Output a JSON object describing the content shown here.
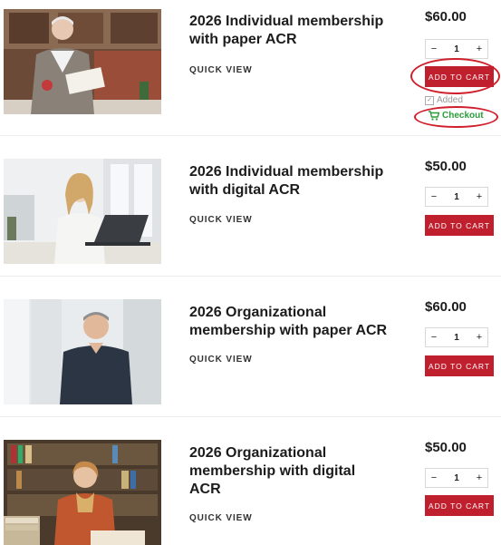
{
  "products": [
    {
      "title_line1": "2026 Individual membership",
      "title_line2": "with paper ACR",
      "title_line3": "",
      "quick_view": "QUICK VIEW",
      "price": "$60.00",
      "qty_minus": "−",
      "qty_value": "1",
      "qty_plus": "+",
      "add_to_cart": "ADD TO CART",
      "added_label": "Added",
      "checkout_label": "Checkout",
      "photo_icon": "woman-reading-photo"
    },
    {
      "title_line1": "2026 Individual membership",
      "title_line2": "with digital ACR",
      "title_line3": "",
      "quick_view": "QUICK VIEW",
      "price": "$50.00",
      "qty_minus": "−",
      "qty_value": "1",
      "qty_plus": "+",
      "add_to_cart": "ADD TO CART",
      "photo_icon": "woman-laptop-photo"
    },
    {
      "title_line1": "2026 Organizational",
      "title_line2": "membership with paper ACR",
      "title_line3": "",
      "quick_view": "QUICK VIEW",
      "price": "$60.00",
      "qty_minus": "−",
      "qty_value": "1",
      "qty_plus": "+",
      "add_to_cart": "ADD TO CART",
      "photo_icon": "man-portrait-photo"
    },
    {
      "title_line1": "2026 Organizational",
      "title_line2": "membership with digital",
      "title_line3": "ACR",
      "quick_view": "QUICK VIEW",
      "price": "$50.00",
      "qty_minus": "−",
      "qty_value": "1",
      "qty_plus": "+",
      "add_to_cart": "ADD TO CART",
      "photo_icon": "woman-library-photo"
    }
  ],
  "colors": {
    "cart_button": "#c0202e",
    "highlight_oval": "#d01f2c",
    "checkout_text": "#2a9d3b"
  }
}
